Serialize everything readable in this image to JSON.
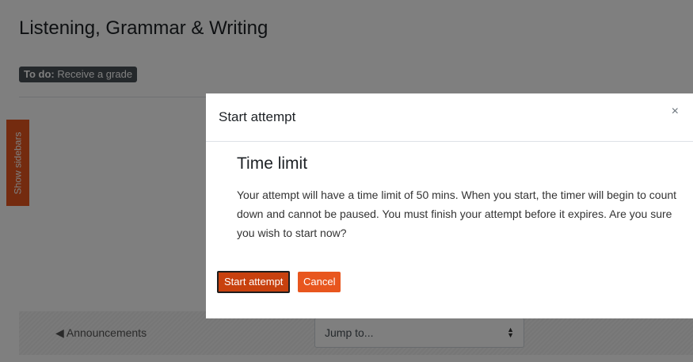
{
  "page": {
    "title": "Listening, Grammar & Writing",
    "todo_label": "To do:",
    "todo_text": "Receive a grade",
    "sidebar_toggle": "Show sidebars",
    "prev_activity": "◀ Announcements",
    "jump_to": {
      "selected": "Jump to..."
    }
  },
  "modal": {
    "title": "Start attempt",
    "close": "×",
    "heading": "Time limit",
    "body": "Your attempt will have a time limit of 50 mins. When you start, the timer will begin to count down and cannot be paused. You must finish your attempt before it expires. Are you sure you wish to start now?",
    "start_button": "Start attempt",
    "cancel_button": "Cancel"
  },
  "colors": {
    "accent": "#e8561e",
    "badge": "#495057"
  }
}
